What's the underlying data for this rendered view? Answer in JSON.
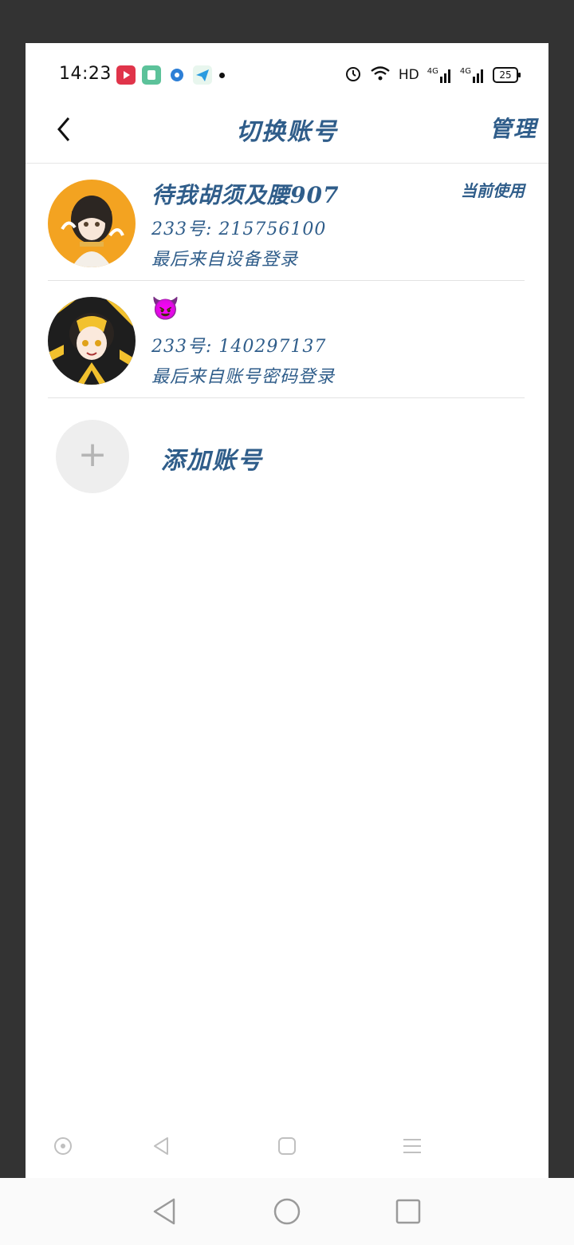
{
  "status_bar": {
    "time": "14:23",
    "network_label": "HD",
    "signal_1": "4G",
    "signal_2": "4G",
    "battery": "25",
    "app_icons": [
      {
        "name": "video-app-icon",
        "color": "#e0344a"
      },
      {
        "name": "money-app-icon",
        "color": "#5cc29a"
      },
      {
        "name": "circle-app-icon",
        "color": "#2d7fd6"
      },
      {
        "name": "telegram-app-icon",
        "color": "#2a9be0"
      }
    ]
  },
  "header": {
    "title": "切换账号",
    "manage_label": "管理"
  },
  "accounts": [
    {
      "name": "待我胡须及腰907",
      "id_line": "233号: 215756100",
      "login_line": "最后来自设备登录",
      "current_tag": "当前使用"
    },
    {
      "name": "😈",
      "id_line": "233号: 140297137",
      "login_line": "最后来自账号密码登录"
    }
  ],
  "add_account": {
    "plus": "+",
    "label": "添加账号"
  },
  "colors": {
    "accent": "#2f5d8a",
    "divider": "#e3e3e3",
    "add_bg": "#eeeeee"
  }
}
